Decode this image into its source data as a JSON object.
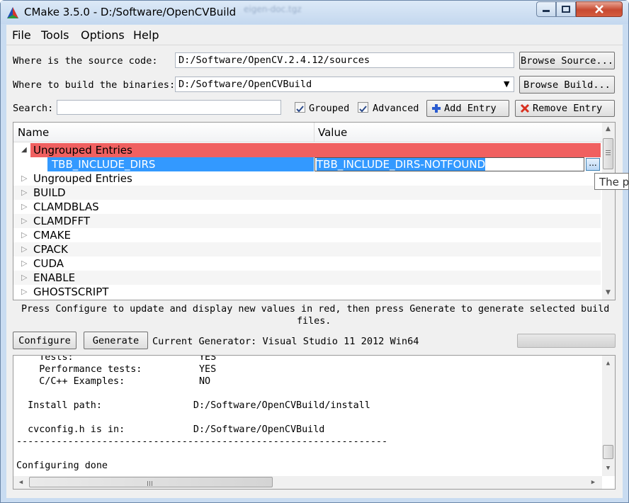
{
  "window": {
    "title": "CMake 3.5.0 - D:/Software/OpenCVBuild",
    "background_tab": "eigen-doc.tgz"
  },
  "menu": {
    "file": "File",
    "tools": "Tools",
    "options": "Options",
    "help": "Help"
  },
  "source": {
    "label": "Where is the source code:",
    "value": "D:/Software/OpenCV.2.4.12/sources",
    "browse": "Browse Source..."
  },
  "build": {
    "label": "Where to build the binaries:",
    "value": "D:/Software/OpenCVBuild",
    "browse": "Browse Build..."
  },
  "search": {
    "label": "Search:",
    "value": "",
    "grouped": "Grouped",
    "grouped_checked": true,
    "advanced": "Advanced",
    "advanced_checked": true,
    "add_entry": "Add Entry",
    "remove_entry": "Remove Entry"
  },
  "tree": {
    "col_name": "Name",
    "col_value": "Value",
    "red_group": "Ungrouped Entries",
    "selected_name": "TBB_INCLUDE_DIRS",
    "selected_value": "TBB_INCLUDE_DIRS-NOTFOUND",
    "browse_btn": "...",
    "groups": [
      "Ungrouped Entries",
      "BUILD",
      "CLAMDBLAS",
      "CLAMDFFT",
      "CMAKE",
      "CPACK",
      "CUDA",
      "ENABLE",
      "GHOSTSCRIPT"
    ]
  },
  "tooltip": "The p",
  "hint": {
    "line1": "Press Configure to update and display new values in red, then press Generate to generate selected build",
    "line2": "files."
  },
  "actions": {
    "configure": "Configure",
    "generate": "Generate",
    "generator": "Current Generator: Visual Studio 11 2012 Win64"
  },
  "output": {
    "lines": [
      "    Tests:                      YES",
      "    Performance tests:          YES",
      "    C/C++ Examples:             NO",
      "",
      "  Install path:                D:/Software/OpenCVBuild/install",
      "",
      "  cvconfig.h is in:            D:/Software/OpenCVBuild",
      "-----------------------------------------------------------------",
      "",
      "Configuring done"
    ]
  },
  "colors": {
    "red_row": "#f06060",
    "selected": "#3399ff"
  }
}
